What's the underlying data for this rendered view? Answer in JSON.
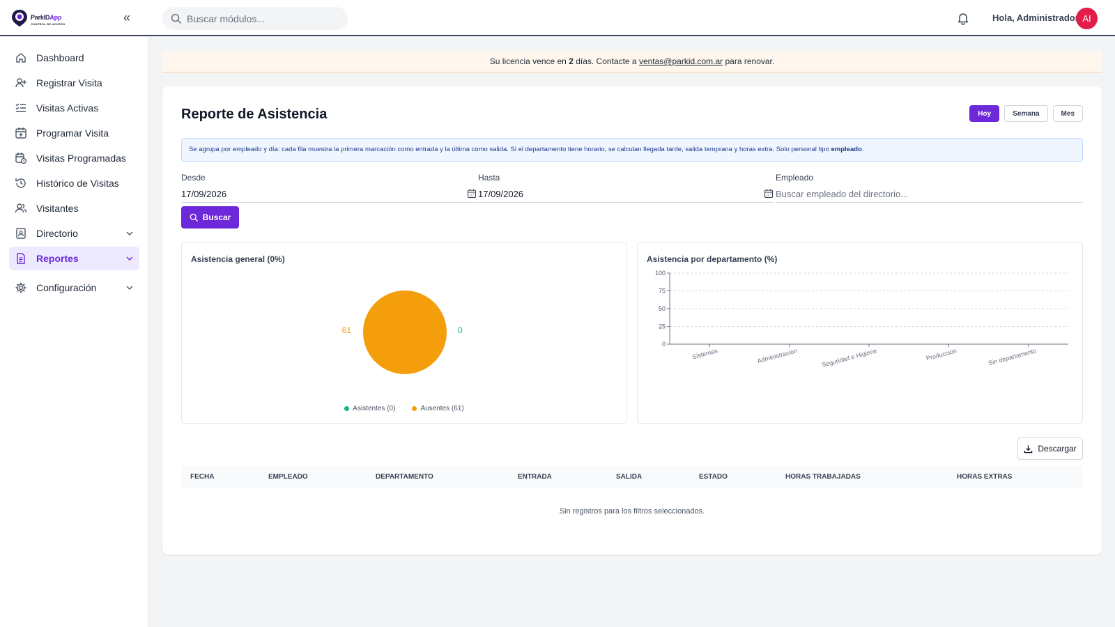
{
  "header": {
    "logo_name_a": "ParkID",
    "logo_name_b": "App",
    "logo_tag": "CONTROL DE ACCESO",
    "collapse_glyph": "«",
    "search_placeholder": "Buscar módulos...",
    "greeting": "Hola, Administrador",
    "avatar_initials": "AI"
  },
  "sidebar": {
    "items": [
      {
        "label": "Dashboard",
        "icon": "home-icon"
      },
      {
        "label": "Registrar Visita",
        "icon": "user-plus-icon"
      },
      {
        "label": "Visitas Activas",
        "icon": "list-check-icon"
      },
      {
        "label": "Programar Visita",
        "icon": "calendar-plus-icon"
      },
      {
        "label": "Visitas Programadas",
        "icon": "calendar-clock-icon"
      },
      {
        "label": "Histórico de Visitas",
        "icon": "history-icon"
      },
      {
        "label": "Visitantes",
        "icon": "users-icon"
      },
      {
        "label": "Directorio",
        "icon": "contact-book-icon"
      },
      {
        "label": "Reportes",
        "icon": "file-report-icon"
      },
      {
        "label": "Configuración",
        "icon": "gear-icon"
      }
    ]
  },
  "banner": {
    "pre": "Su licencia vence en ",
    "days": "2",
    "mid": " días. Contacte a ",
    "email": "ventas@parkid.com.ar",
    "post": " para renovar."
  },
  "report": {
    "title": "Reporte de Asistencia",
    "ranges": [
      "Hoy",
      "Semana",
      "Mes"
    ],
    "info_text": "Se agrupa por empleado y día: cada fila muestra la primera marcación como entrada y la última como salida. Si el departamento tiene horario, se calculan llegada tarde, salida temprana y horas extra. Solo personal tipo ",
    "info_bold": "empleado",
    "info_end": ".",
    "desde_label": "Desde",
    "desde_value": "17/09/2026",
    "hasta_label": "Hasta",
    "hasta_value": "17/09/2026",
    "empleado_label": "Empleado",
    "empleado_placeholder": "Buscar empleado del directorio...",
    "buscar_label": "Buscar",
    "descargar_label": "Descargar",
    "table_headers": [
      "FECHA",
      "EMPLEADO",
      "DEPARTAMENTO",
      "ENTRADA",
      "SALIDA",
      "ESTADO",
      "HORAS TRABAJADAS",
      "HORAS EXTRAS"
    ],
    "empty_text": "Sin registros para los filtros seleccionados."
  },
  "chart_data": [
    {
      "type": "pie",
      "title": "Asistencia general (0%)",
      "slices": [
        {
          "name": "Asistentes (0)",
          "value": 0,
          "color": "#10b981"
        },
        {
          "name": "Ausentes (61)",
          "value": 61,
          "color": "#f59e0b"
        }
      ],
      "labels": [
        "61",
        "0"
      ]
    },
    {
      "type": "bar",
      "title": "Asistencia por departamento (%)",
      "categories": [
        "Sistemas",
        "Administracion",
        "Seguridad e Higiene",
        "Produccion",
        "Sin departamento"
      ],
      "values": [
        0,
        0,
        0,
        0,
        0
      ],
      "ylim": [
        0,
        100
      ],
      "yticks": [
        0,
        25,
        50,
        75,
        100
      ],
      "grid": true
    }
  ]
}
